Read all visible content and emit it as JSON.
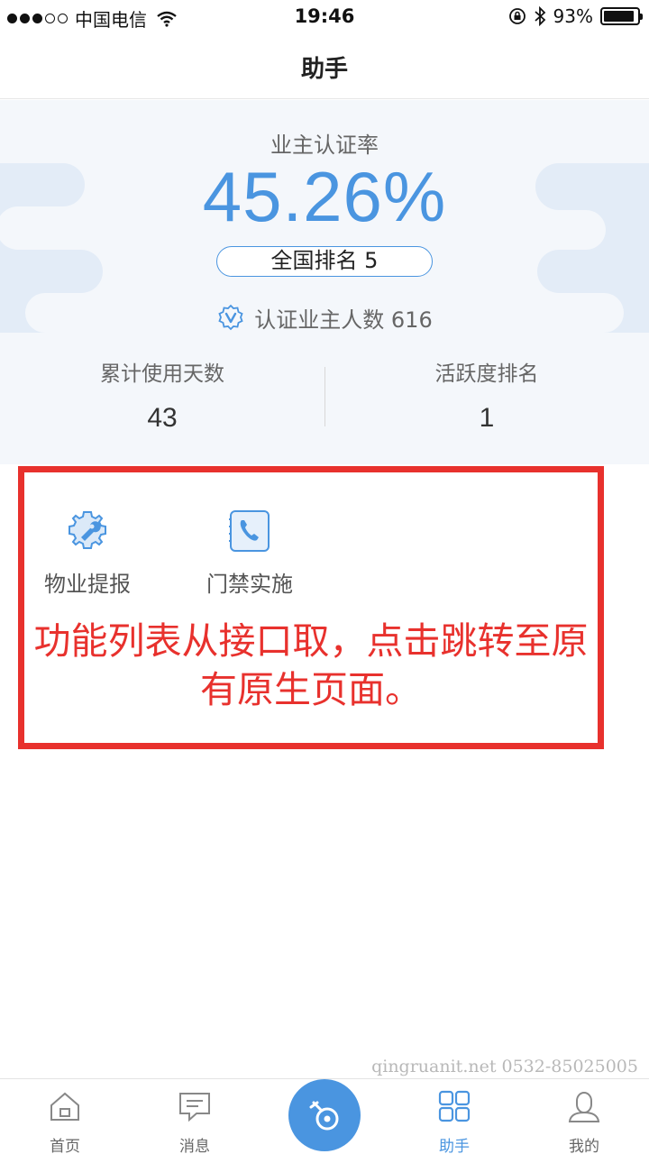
{
  "status_bar": {
    "carrier": "中国电信",
    "time": "19:46",
    "battery": "93%",
    "battery_level": 0.93
  },
  "nav": {
    "title": "助手"
  },
  "stats": {
    "rate_label": "业主认证率",
    "rate_value": "45.26%",
    "rank_text": "全国排名 5",
    "verified_text": "认证业主人数 616",
    "days_label": "累计使用天数",
    "days_value": "43",
    "activity_label": "活跃度排名",
    "activity_value": "1"
  },
  "functions": [
    {
      "label": "物业提报",
      "icon": "gear-wrench-icon"
    },
    {
      "label": "门禁实施",
      "icon": "phone-icon"
    }
  ],
  "annotation": "功能列表从接口取，点击跳转至原有原生页面。",
  "watermark": "qingruanit.net 0532-85025005",
  "tabs": [
    {
      "label": "首页",
      "icon": "home-icon"
    },
    {
      "label": "消息",
      "icon": "message-icon"
    },
    {
      "label": "助手",
      "icon": "grid-icon",
      "active": true
    },
    {
      "label": "我的",
      "icon": "user-icon"
    }
  ],
  "colors": {
    "accent": "#4a95e0",
    "annotation": "#e8312d"
  }
}
